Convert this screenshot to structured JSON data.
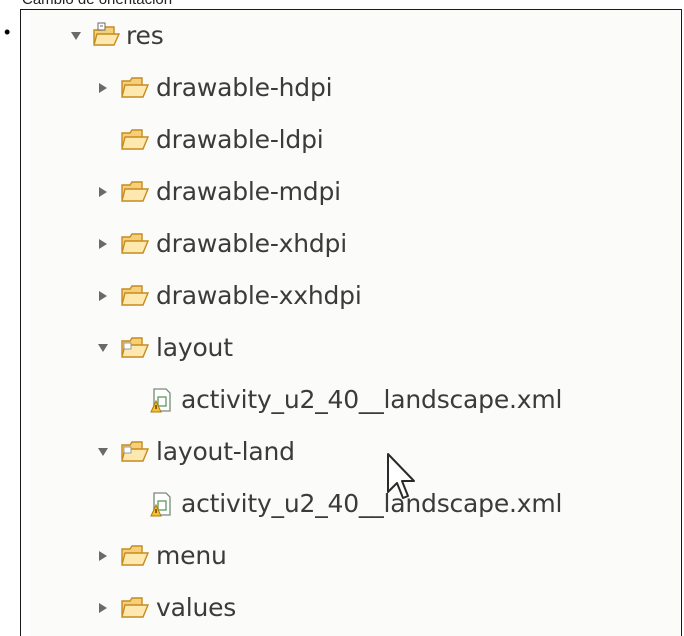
{
  "caption": "Cambio de orientación",
  "bullet": "•",
  "tree": {
    "root": {
      "label": "res",
      "expanded": true,
      "icon": "resource-folder-icon"
    },
    "items": [
      {
        "label": "drawable-hdpi",
        "twisty": "collapsed"
      },
      {
        "label": "drawable-ldpi",
        "twisty": "none"
      },
      {
        "label": "drawable-mdpi",
        "twisty": "collapsed"
      },
      {
        "label": "drawable-xhdpi",
        "twisty": "collapsed"
      },
      {
        "label": "drawable-xxhdpi",
        "twisty": "collapsed"
      },
      {
        "label": "layout",
        "twisty": "expanded"
      },
      {
        "label": "activity_u2_40__landscape.xml",
        "type": "xml-file"
      },
      {
        "label": "layout-land",
        "twisty": "expanded"
      },
      {
        "label": "activity_u2_40__landscape.xml",
        "type": "xml-file"
      },
      {
        "label": "menu",
        "twisty": "collapsed"
      },
      {
        "label": "values",
        "twisty": "collapsed"
      }
    ]
  },
  "colors": {
    "folder_fill": "#f4d07a",
    "folder_stroke": "#c88a1c",
    "text": "#3b3b3b",
    "twisty": "#6a6a6a"
  }
}
